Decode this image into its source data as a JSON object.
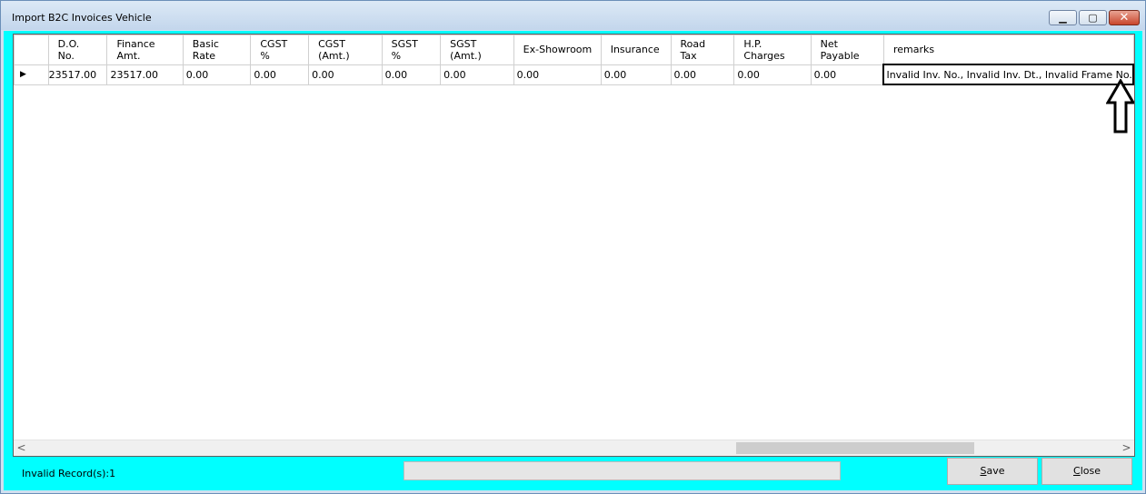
{
  "window": {
    "title": "Import B2C Invoices Vehicle",
    "controls": {
      "minimize_icon": "minimize-icon",
      "maximize_icon": "maximize-icon",
      "close_icon": "close-icon"
    }
  },
  "grid": {
    "columns": [
      "D.O.\nNo.",
      "Finance\nAmt.",
      "Basic\nRate",
      "CGST\n%",
      "CGST\n(Amt.)",
      "SGST\n%",
      "SGST\n(Amt.)",
      "Ex-Showroom",
      "Insurance",
      "Road\nTax",
      "H.P.\nCharges",
      "Net\nPayable",
      "remarks"
    ],
    "rows": [
      [
        "23517.00",
        "23517.00",
        "0.00",
        "0.00",
        "0.00",
        "0.00",
        "0.00",
        "0.00",
        "0.00",
        "0.00",
        "0.00",
        "0.00",
        "Invalid Inv. No., Invalid Inv. Dt., Invalid Frame No."
      ]
    ],
    "current_row_indicator": "▶"
  },
  "scrollbar": {
    "left": "<",
    "right": ">"
  },
  "footer": {
    "status": "Invalid Record(s):1",
    "save_mnemonic": "S",
    "save_rest": "ave",
    "close_mnemonic": "C",
    "close_rest": "lose"
  },
  "colors": {
    "client_background": "#00ffff",
    "window_frame": "#cfdff0"
  }
}
